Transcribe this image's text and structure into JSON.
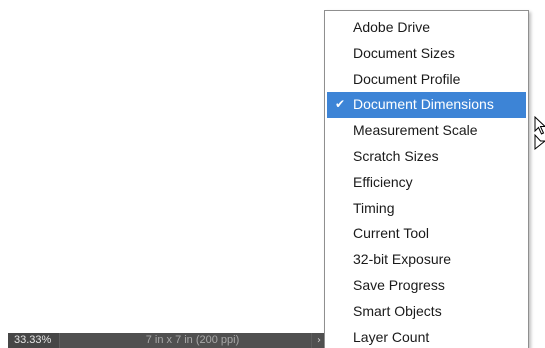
{
  "status_bar": {
    "zoom": "33.33%",
    "doc_info": "7 in x 7 in (200 ppi)",
    "arrow_glyph": "›"
  },
  "menu": {
    "items": [
      {
        "label": "Adobe Drive",
        "selected": false
      },
      {
        "label": "Document Sizes",
        "selected": false
      },
      {
        "label": "Document Profile",
        "selected": false
      },
      {
        "label": "Document Dimensions",
        "selected": true
      },
      {
        "label": "Measurement Scale",
        "selected": false
      },
      {
        "label": "Scratch Sizes",
        "selected": false
      },
      {
        "label": "Efficiency",
        "selected": false
      },
      {
        "label": "Timing",
        "selected": false
      },
      {
        "label": "Current Tool",
        "selected": false
      },
      {
        "label": "32-bit Exposure",
        "selected": false
      },
      {
        "label": "Save Progress",
        "selected": false
      },
      {
        "label": "Smart Objects",
        "selected": false
      },
      {
        "label": "Layer Count",
        "selected": false
      }
    ],
    "check_glyph": "✔"
  },
  "colors": {
    "selection": "#3d84d6",
    "status_bar": "#505050"
  },
  "icons": {
    "check": "checkmark-icon",
    "cursor": "mouse-pointer-icon",
    "status_arrow": "chevron-right-icon"
  }
}
